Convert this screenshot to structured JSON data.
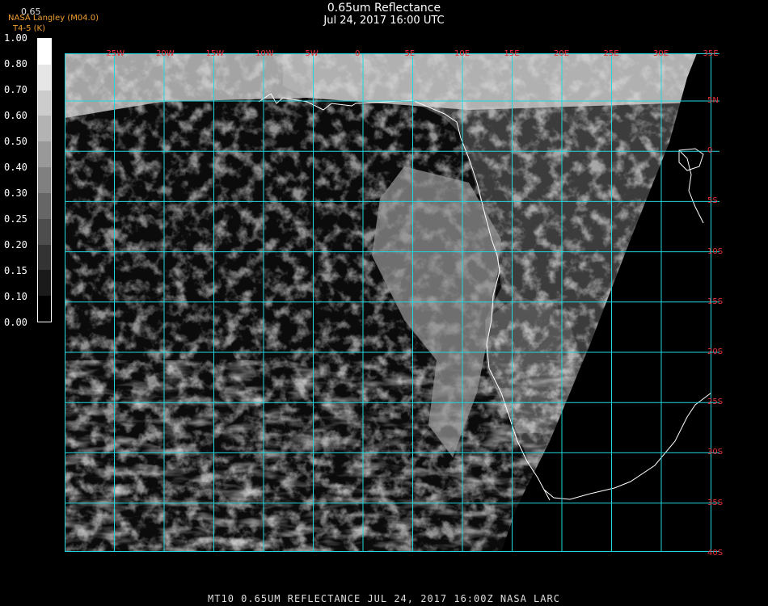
{
  "title": "0.65um Reflectance",
  "subtitle": "Jul 24, 2017 16:00 UTC",
  "credit": "NASA Langley (M04.0)",
  "credit_sub": "T4-5 (K)",
  "product_top": "0.65",
  "colorbar": {
    "labels": [
      "1.00",
      "0.80",
      "0.70",
      "0.60",
      "0.50",
      "0.40",
      "0.30",
      "0.25",
      "0.20",
      "0.15",
      "0.10",
      "0.00"
    ]
  },
  "map": {
    "lon_labels": [
      "25W",
      "20W",
      "15W",
      "10W",
      "5W",
      "0",
      "5E",
      "10E",
      "15E",
      "20E",
      "25E",
      "30E",
      "35E"
    ],
    "lat_labels": [
      "5N",
      "0",
      "5S",
      "10S",
      "15S",
      "20S",
      "25S",
      "30S",
      "35S",
      "40S"
    ]
  },
  "footer": "MT10  0.65UM REFLECTANCE   JUL 24, 2017 16:00Z   NASA LARC",
  "colors": {
    "grid": "#21d6dc",
    "coast": "#ffffff",
    "label": "#e8303a",
    "credit": "#f0a030"
  }
}
